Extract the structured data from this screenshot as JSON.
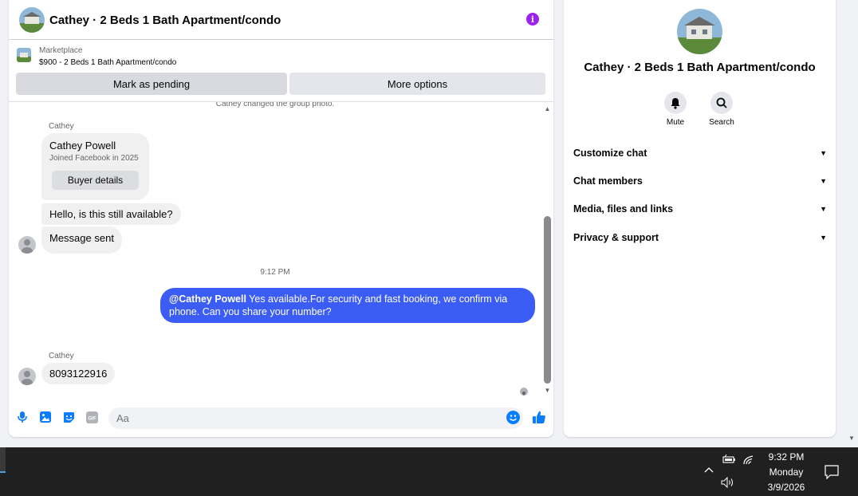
{
  "chat": {
    "title": "Cathey · 2 Beds 1 Bath Apartment/condo",
    "marketplace_label": "Marketplace",
    "listing": "$900 - 2 Beds 1 Bath Apartment/condo",
    "mark_pending": "Mark as pending",
    "more_options": "More options",
    "system_message": "Cathey changed the group photo.",
    "messages": {
      "sender_1": "Cathey",
      "card_name": "Cathey Powell",
      "card_sub": "Joined Facebook in 2025",
      "card_button": "Buyer details",
      "msg_1": "Hello, is this still available?",
      "msg_2": "Message sent",
      "timestamp": "9:12 PM",
      "out_mention": "@Cathey Powell",
      "out_text": " Yes available.For security and fast booking, we confirm via phone. Can you share your number?",
      "sender_2": "Cathey",
      "msg_3": "8093122916"
    },
    "composer_placeholder": "Aa"
  },
  "side": {
    "title": "Cathey · 2 Beds 1 Bath Apartment/condo",
    "mute": "Mute",
    "search": "Search",
    "rows": [
      "Customize chat",
      "Chat members",
      "Media, files and links",
      "Privacy & support"
    ]
  },
  "taskbar": {
    "time": "9:32 PM",
    "day": "Monday",
    "date": "3/9/2026"
  },
  "colors": {
    "accent": "#3b5cf5",
    "info": "#a020f0",
    "messenger_blue": "#0a7cff"
  },
  "icons": [
    "info-icon",
    "mic-icon",
    "image-icon",
    "sticker-icon",
    "gif-icon",
    "emoji-icon",
    "like-icon",
    "bell-icon",
    "search-icon",
    "chevron-down-icon",
    "battery-icon",
    "wifi-icon",
    "volume-icon",
    "notification-icon"
  ]
}
